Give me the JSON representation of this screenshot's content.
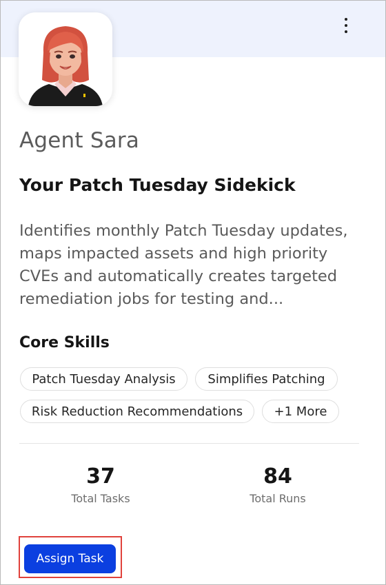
{
  "card": {
    "menu_icon": "more-vertical-icon",
    "avatar": "agent-avatar-illustration",
    "agent_name": "Agent Sara",
    "tagline": "Your Patch Tuesday Sidekick",
    "description": "Identifies monthly Patch Tuesday updates, maps impacted assets and high priority CVEs and automatically creates targeted remediation jobs for testing and..."
  },
  "skills": {
    "title": "Core Skills",
    "items": [
      "Patch Tuesday Analysis",
      "Simplifies Patching",
      "Risk Reduction Recommendations"
    ],
    "more_label": "+1 More"
  },
  "stats": [
    {
      "value": "37",
      "label": "Total Tasks"
    },
    {
      "value": "84",
      "label": "Total Runs"
    }
  ],
  "actions": {
    "assign_label": "Assign Task"
  },
  "colors": {
    "header_band": "#eef2fd",
    "primary_button": "#0b3fe0",
    "highlight_border": "#e0413b"
  }
}
